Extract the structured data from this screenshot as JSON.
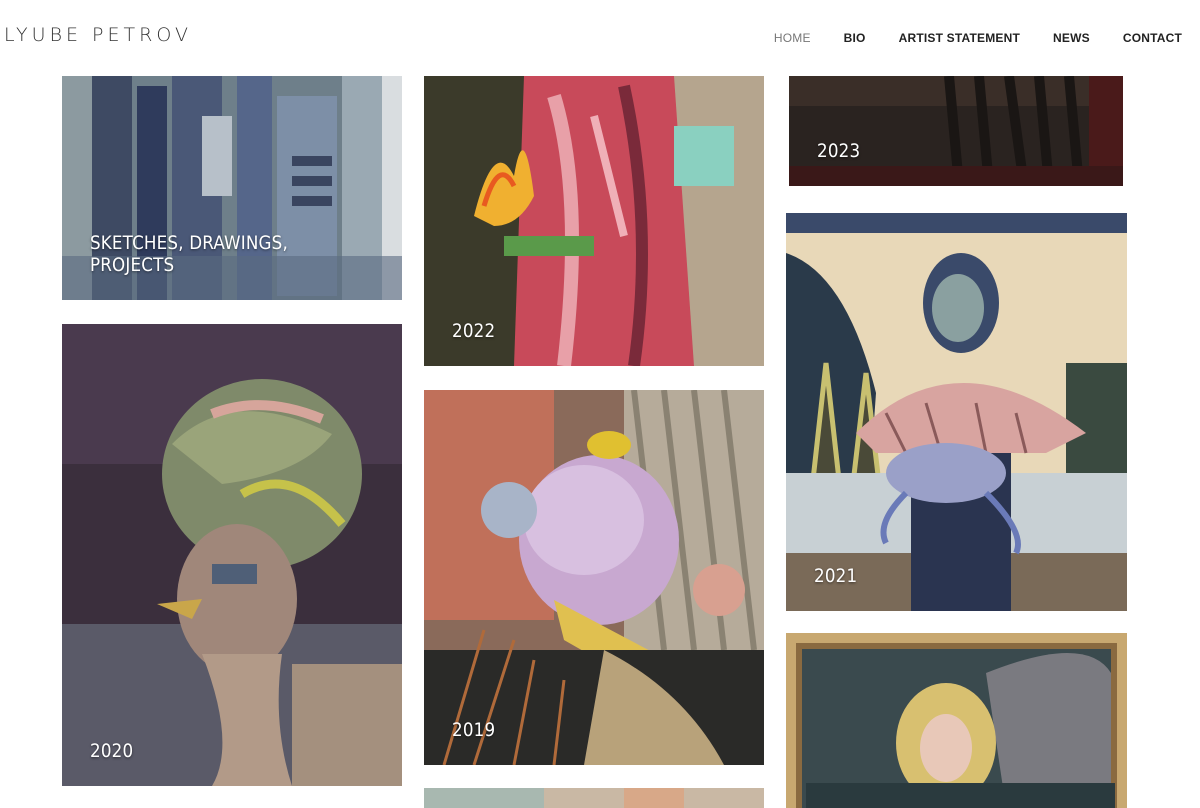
{
  "header": {
    "logo": "LYUBE PETROV",
    "nav": [
      {
        "label": "HOME",
        "active": true
      },
      {
        "label": "BIO",
        "active": false
      },
      {
        "label": "ARTIST STATEMENT",
        "active": false
      },
      {
        "label": "NEWS",
        "active": false
      },
      {
        "label": "CONTACT",
        "active": false
      }
    ]
  },
  "gallery": {
    "sketches": "SKETCHES, DRAWINGS, PROJECTS",
    "y2020": "2020",
    "y2022": "2022",
    "y2019": "2019",
    "y2023": "2023",
    "y2021": "2021"
  },
  "colors": {
    "nav_active": "#777777",
    "nav_default": "#222222",
    "caption": "#ffffff"
  }
}
